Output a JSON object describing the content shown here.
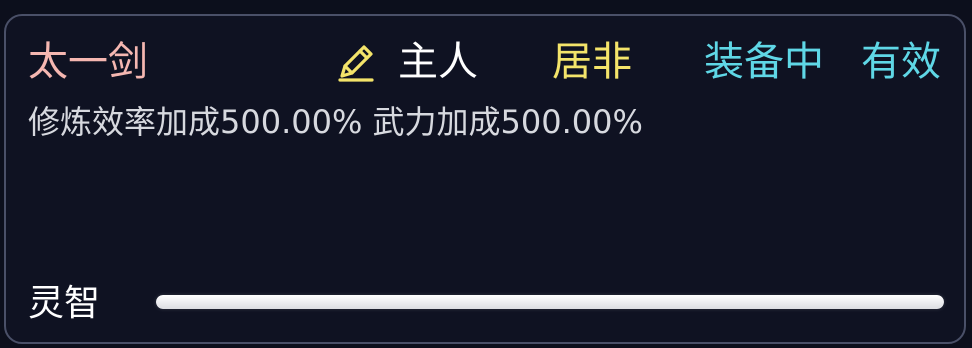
{
  "item": {
    "name": "太一剑",
    "owner": "主人",
    "residence": "居非",
    "equip_status": "装备中",
    "effect_status": "有效"
  },
  "effects": {
    "text": "修炼效率加成500.00% 武力加成500.00%"
  },
  "stat": {
    "label": "灵智",
    "fill_fraction": 1.0
  },
  "icons": {
    "edit": "pencil-icon"
  },
  "colors": {
    "name": "#f5b7b1",
    "residence": "#f4e46a",
    "status": "#5fd7e6",
    "pencil": "#f4e46a"
  }
}
